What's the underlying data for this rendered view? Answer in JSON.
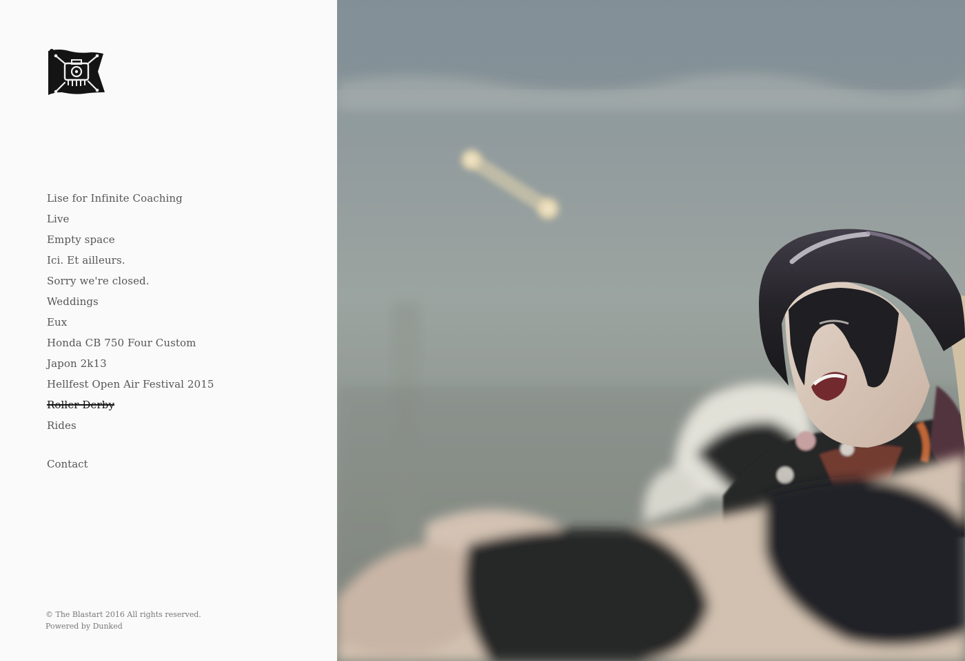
{
  "logo": {
    "icon": "pirate-flag-camera-icon",
    "alt": "The Blastart"
  },
  "nav": {
    "items": [
      {
        "label": "Lise for Infinite Coaching",
        "active": false
      },
      {
        "label": "Live",
        "active": false
      },
      {
        "label": "Empty space",
        "active": false
      },
      {
        "label": "Ici. Et ailleurs.",
        "active": false
      },
      {
        "label": "Sorry we're closed.",
        "active": false
      },
      {
        "label": "Weddings",
        "active": false
      },
      {
        "label": "Eux",
        "active": false
      },
      {
        "label": "Honda CB 750 Four Custom",
        "active": false
      },
      {
        "label": "Japon 2k13",
        "active": false
      },
      {
        "label": "Hellfest Open Air Festival 2015",
        "active": false
      },
      {
        "label": "Roller Derby",
        "active": true
      },
      {
        "label": "Rides",
        "active": false
      }
    ],
    "contact_label": "Contact"
  },
  "footer": {
    "copyright": "© The Blastart 2016 All rights reserved.",
    "powered_prefix": "Powered by ",
    "powered_link": "Dunked"
  },
  "photo": {
    "alt": "Roller derby player with black face paint and helmet"
  },
  "colors": {
    "background": "#fafafa",
    "nav_text": "#555555",
    "active_text": "#111111",
    "footer_text": "#777777"
  }
}
